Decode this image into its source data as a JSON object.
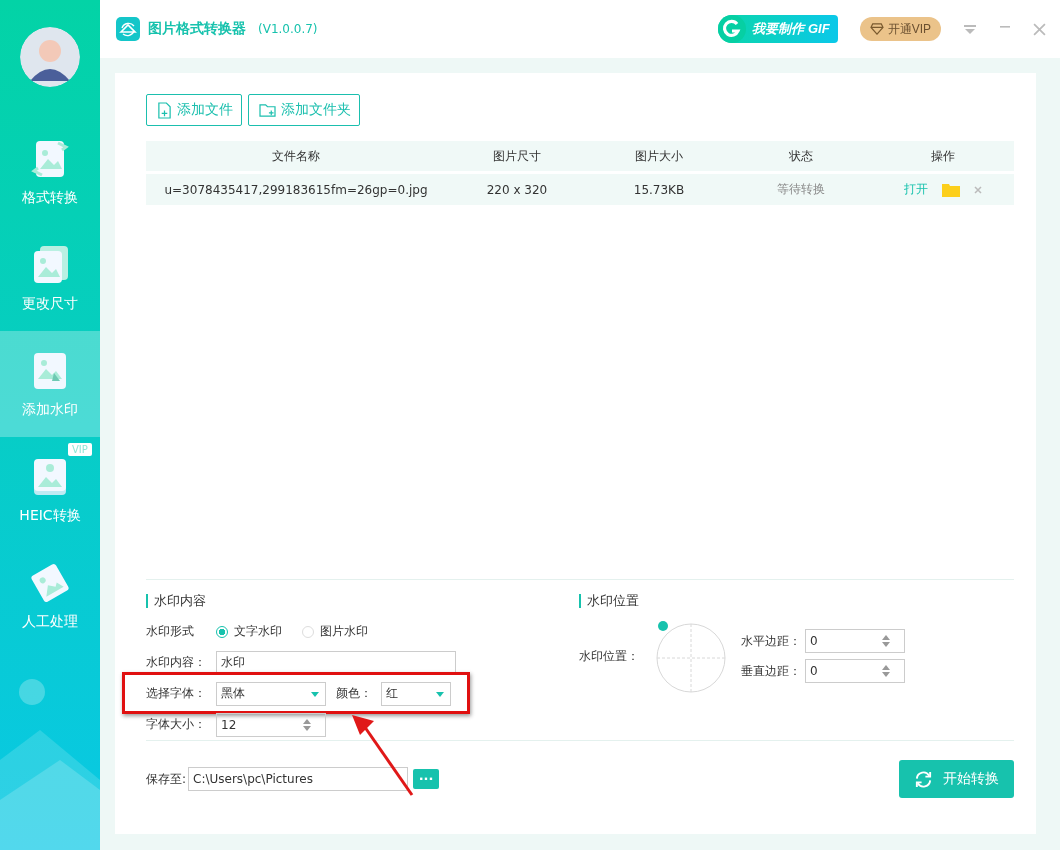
{
  "app": {
    "title": "图片格式转换器",
    "version": "(V1.0.0.7)",
    "gif_button": "我要制作 GIF",
    "vip_button": "开通VIP"
  },
  "sidebar": {
    "items": [
      {
        "label": "格式转换",
        "selected": false,
        "kind": "convert"
      },
      {
        "label": "更改尺寸",
        "selected": false,
        "kind": "resize"
      },
      {
        "label": "添加水印",
        "selected": true,
        "kind": "watermark"
      },
      {
        "label": "HEIC转换",
        "selected": false,
        "kind": "heic",
        "badge": "VIP"
      },
      {
        "label": "人工处理",
        "selected": false,
        "kind": "manual"
      }
    ]
  },
  "toolbar": {
    "buttons": [
      {
        "label": "添加文件",
        "kind": "file"
      },
      {
        "label": "添加文件夹",
        "kind": "folder"
      }
    ]
  },
  "table": {
    "columns": [
      "文件名称",
      "图片尺寸",
      "图片大小",
      "状态",
      "操作"
    ],
    "rows": [
      {
        "file_name": "u=3078435417,299183615fm=26gp=0.jpg",
        "dimensions": "220 x 320",
        "file_size": "15.73KB",
        "status": "等待转换",
        "open_link": "打开"
      }
    ]
  },
  "watermark_content": {
    "title": "水印内容",
    "type_label": "水印形式",
    "type_options": [
      {
        "label": "文字水印",
        "selected": true
      },
      {
        "label": "图片水印",
        "selected": false
      }
    ],
    "content_label": "水印内容：",
    "content_value": "水印",
    "font_label": "选择字体：",
    "font_value": "黑体",
    "color_label": "颜色：",
    "color_value": "红",
    "size_label": "字体大小：",
    "size_value": "12"
  },
  "watermark_position": {
    "title": "水印位置",
    "position_label": "水印位置：",
    "horizontal_label": "水平边距：",
    "horizontal_value": "0",
    "vertical_label": "垂直边距：",
    "vertical_value": "0"
  },
  "save": {
    "label": "保存至:",
    "path": "C:\\Users\\pc\\Pictures",
    "browse_button": "···"
  },
  "start_button": "开始转换"
}
